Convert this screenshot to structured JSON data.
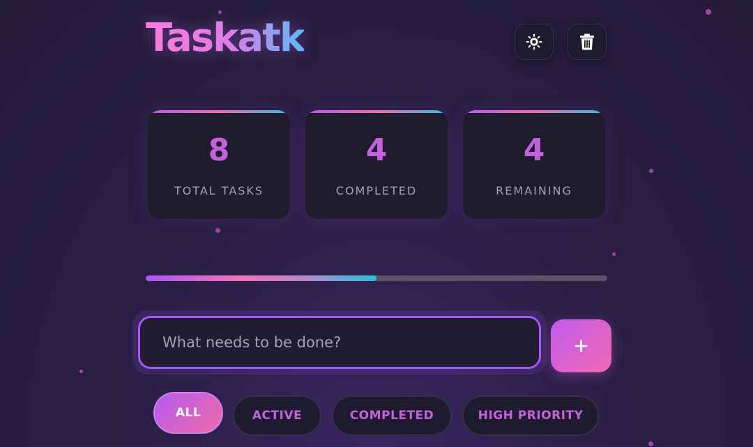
{
  "app": {
    "title": "Taskatk"
  },
  "header": {
    "theme_icon": "sun-icon",
    "clear_icon": "trash-icon"
  },
  "stats": [
    {
      "value": "8",
      "label": "TOTAL TASKS"
    },
    {
      "value": "4",
      "label": "COMPLETED"
    },
    {
      "value": "4",
      "label": "REMAINING"
    }
  ],
  "progress": {
    "fraction": 0.5
  },
  "input": {
    "value": "",
    "placeholder": "What needs to be done?"
  },
  "add_button": {
    "label": "+"
  },
  "filters": [
    {
      "label": "ALL",
      "selected": true
    },
    {
      "label": "ACTIVE",
      "selected": false
    },
    {
      "label": "COMPLETED",
      "selected": false
    },
    {
      "label": "HIGH PRIORITY",
      "selected": false
    }
  ],
  "colors": {
    "accent": "#a855f7",
    "pink": "#f06aa8",
    "cyan": "#22c3dd",
    "stat_number": "#c561dd"
  }
}
